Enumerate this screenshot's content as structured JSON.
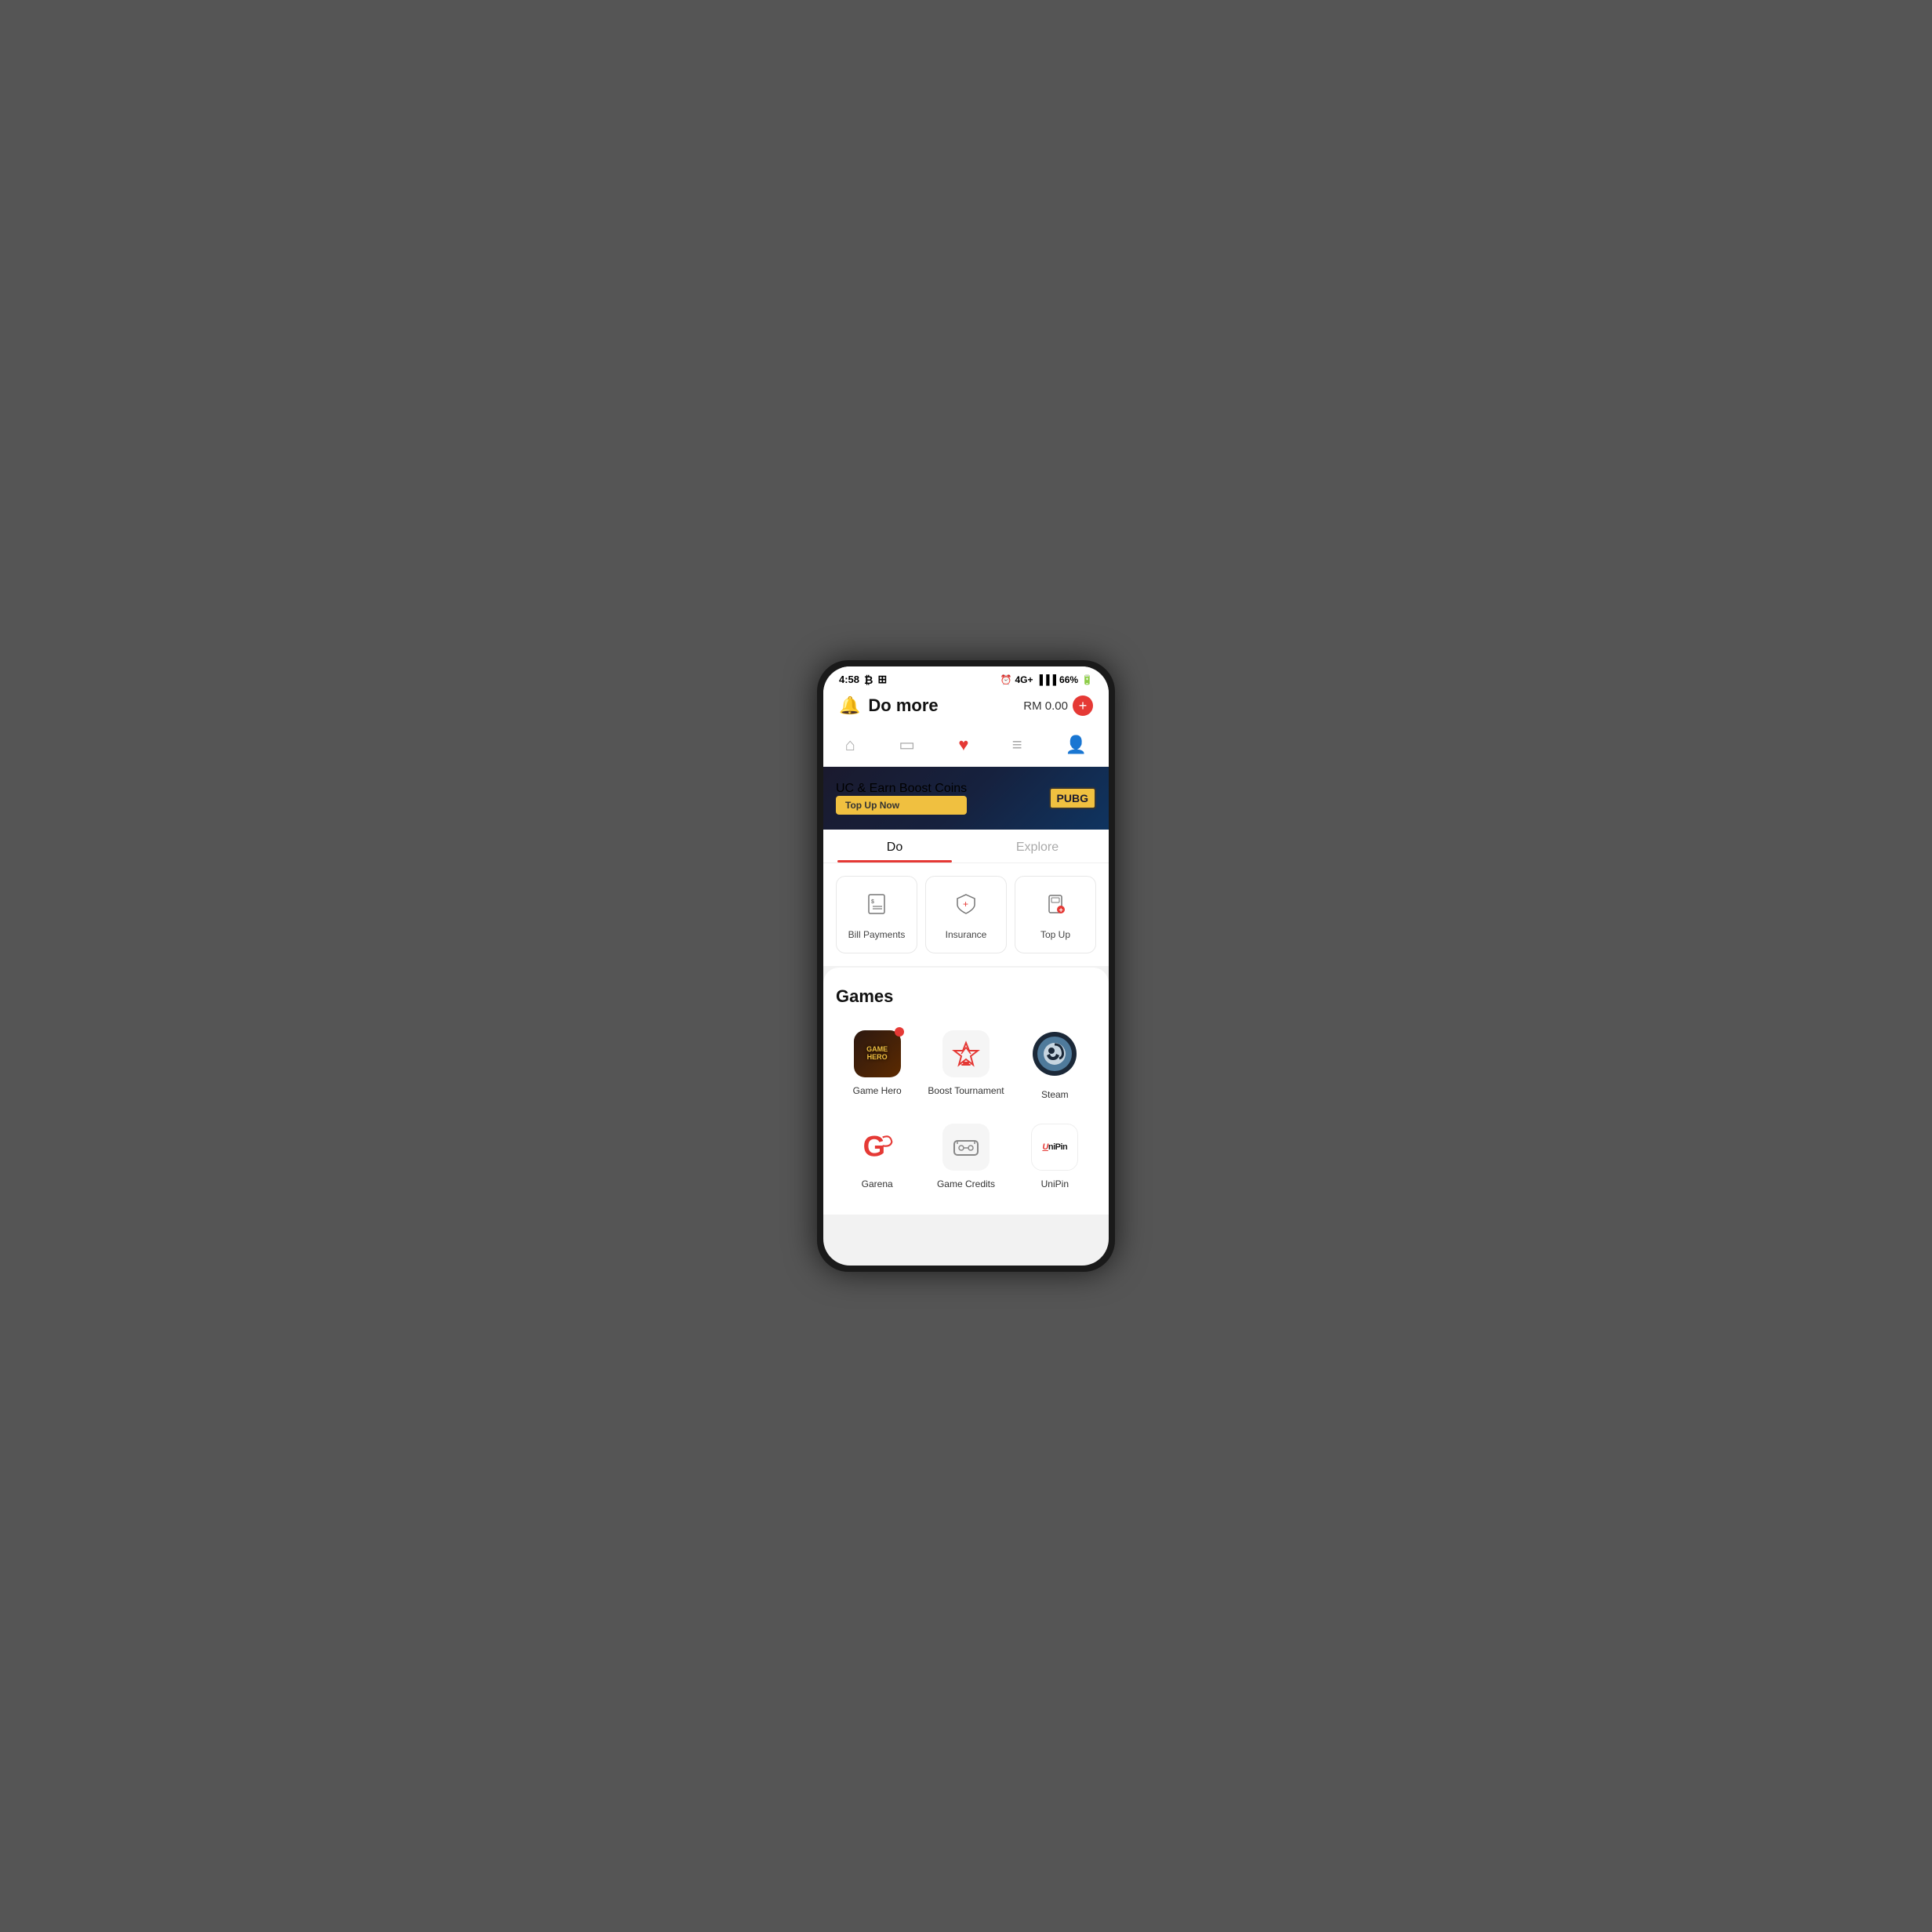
{
  "statusBar": {
    "time": "4:58",
    "battery": "66%",
    "signal": "4G+"
  },
  "header": {
    "title": "Do more",
    "balance": "RM 0.00",
    "addLabel": "+"
  },
  "nav": {
    "items": [
      {
        "id": "home",
        "icon": "🏠",
        "active": false
      },
      {
        "id": "card",
        "icon": "⊡",
        "active": false
      },
      {
        "id": "heart",
        "icon": "♡",
        "active": true
      },
      {
        "id": "list",
        "icon": "☰",
        "active": false
      },
      {
        "id": "user",
        "icon": "👤",
        "active": false
      }
    ]
  },
  "banner": {
    "text": "UC & Earn Boost Coins",
    "buttonLabel": "Top Up Now",
    "logoText": "PUBG"
  },
  "tabs": [
    {
      "id": "do",
      "label": "Do",
      "active": true
    },
    {
      "id": "explore",
      "label": "Explore",
      "active": false
    }
  ],
  "services": [
    {
      "id": "bill-payments",
      "icon": "📄",
      "label": "Bill Payments"
    },
    {
      "id": "insurance",
      "icon": "🛡",
      "label": "Insurance"
    },
    {
      "id": "top-up",
      "icon": "📱",
      "label": "Top Up"
    }
  ],
  "games": {
    "sectionTitle": "Games",
    "items": [
      {
        "id": "game-hero",
        "label": "Game Hero",
        "hasBadge": true
      },
      {
        "id": "boost-tournament",
        "label": "Boost Tournament",
        "hasBadge": false
      },
      {
        "id": "steam",
        "label": "Steam",
        "hasBadge": false
      },
      {
        "id": "garena",
        "label": "Garena",
        "hasBadge": false
      },
      {
        "id": "game-credits",
        "label": "Game Credits",
        "hasBadge": false
      },
      {
        "id": "unipin",
        "label": "UniPin",
        "hasBadge": false
      }
    ]
  }
}
